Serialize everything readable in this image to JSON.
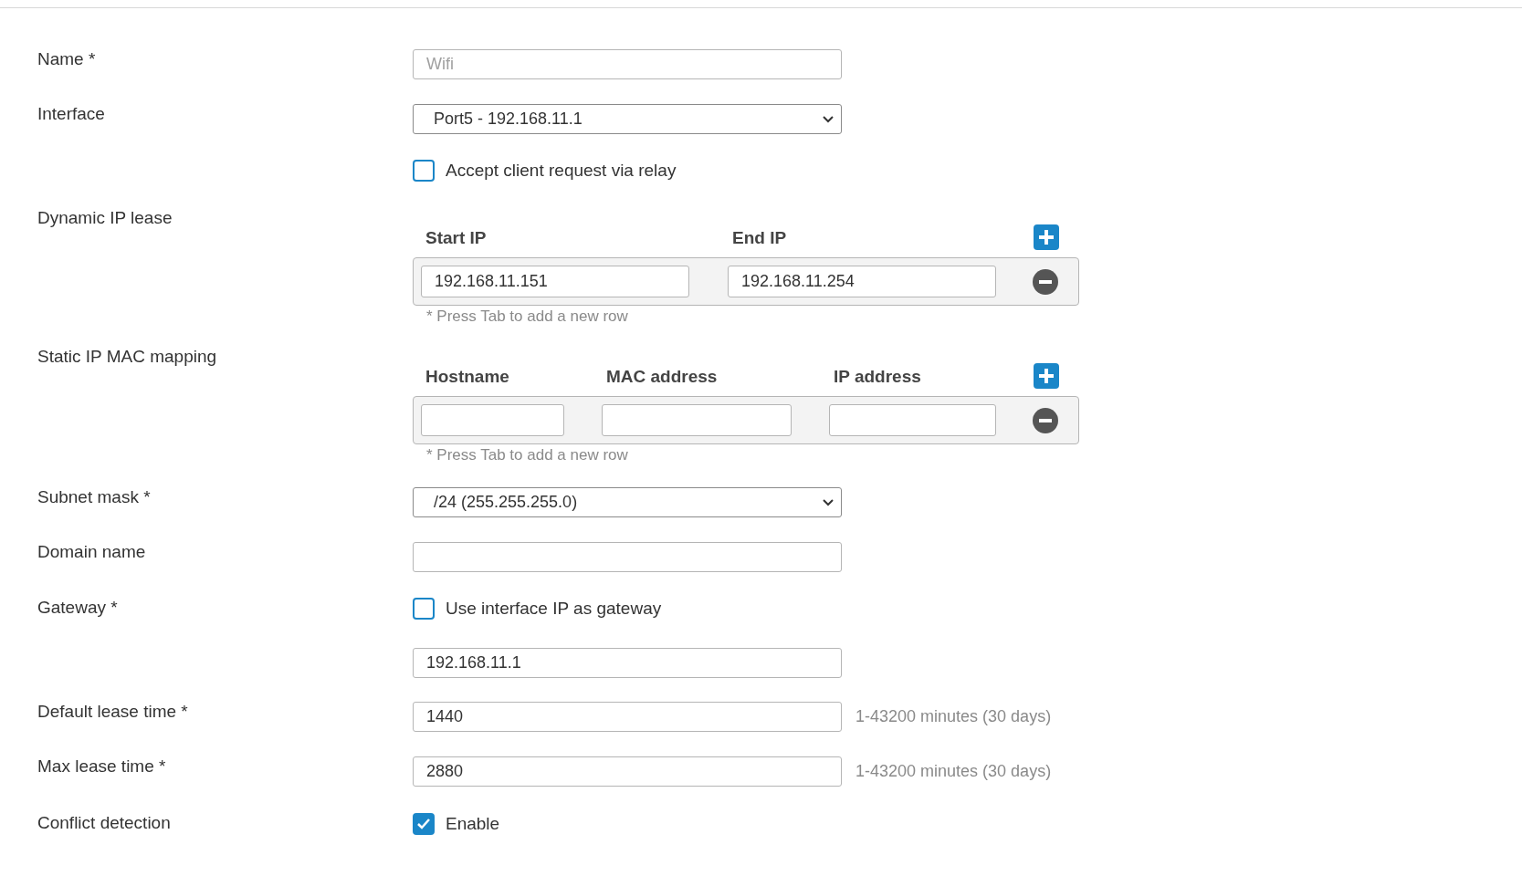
{
  "name": {
    "label": "Name *",
    "placeholder": "Wifi"
  },
  "interface": {
    "label": "Interface",
    "value": "Port5 - 192.168.11.1"
  },
  "relay": {
    "label": "Accept client request via relay",
    "checked": false
  },
  "dynamic_ip_lease": {
    "label": "Dynamic IP lease",
    "columns": [
      "Start IP",
      "End IP"
    ],
    "rows": [
      {
        "values": [
          "192.168.11.151",
          "192.168.11.254"
        ]
      }
    ],
    "note": "* Press Tab to add a new row"
  },
  "static_ip_mac_mapping": {
    "label": "Static IP MAC mapping",
    "columns": [
      "Hostname",
      "MAC address",
      "IP address"
    ],
    "rows": [
      {
        "blank": true
      }
    ],
    "note": "* Press Tab to add a new row"
  },
  "subnet_mask": {
    "label": "Subnet mask *",
    "value": "/24 (255.255.255.0)"
  },
  "domain_name": {
    "label": "Domain name"
  },
  "gateway": {
    "label": "Gateway *",
    "checkbox_label": "Use interface IP as gateway",
    "checked": false,
    "value": "192.168.11.1"
  },
  "default_lease_time": {
    "label": "Default lease time *",
    "value": "1440",
    "hint": "1-43200 minutes (30 days)"
  },
  "max_lease_time": {
    "label": "Max lease time *",
    "value": "2880",
    "hint": "1-43200 minutes (30 days)"
  },
  "conflict_detection": {
    "label": "Conflict detection",
    "checkbox_label": "Enable",
    "checked": true
  }
}
